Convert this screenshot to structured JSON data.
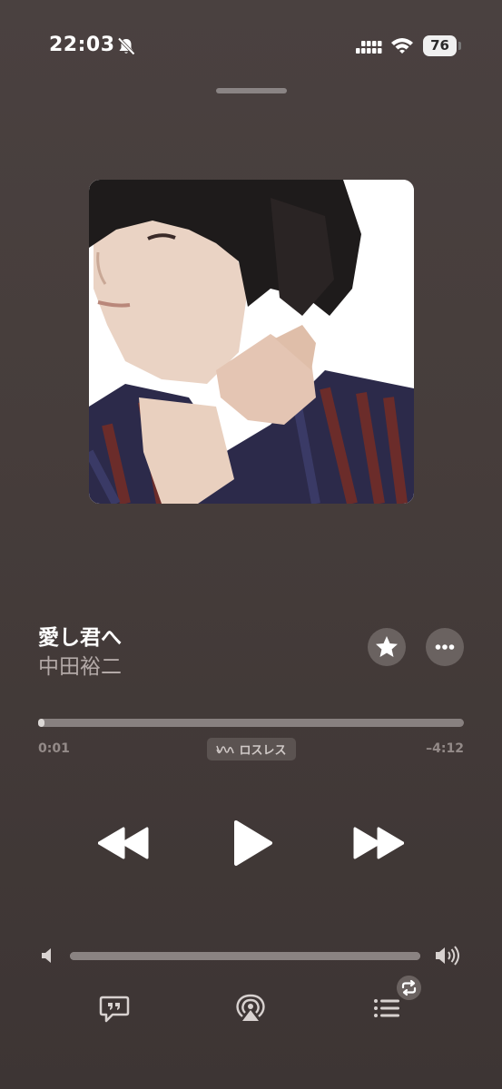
{
  "status_bar": {
    "time": "22:03",
    "battery_percent": "76",
    "icons": [
      "bell-slash-icon",
      "cellular-signal-icon",
      "wifi-icon",
      "battery-icon"
    ]
  },
  "now_playing": {
    "title": "愛し君へ",
    "artist": "中田裕二",
    "artwork_icon": "album-artwork"
  },
  "actions": {
    "favorite_icon": "star-icon",
    "more_icon": "ellipsis-icon"
  },
  "progress": {
    "elapsed": "0:01",
    "remaining": "–4:12",
    "fraction": 0.004,
    "badge_label": "ロスレス",
    "badge_icon": "lossless-icon"
  },
  "transport": {
    "rewind_icon": "backward-icon",
    "play_icon": "play-icon",
    "forward_icon": "forward-icon"
  },
  "volume": {
    "level": 1.0,
    "low_icon": "speaker-icon",
    "high_icon": "speaker-wave-icon"
  },
  "bottom_bar": {
    "lyrics_icon": "quote-bubble-icon",
    "airplay_icon": "airplay-audio-icon",
    "queue_icon": "list-icon",
    "repeat_badge_icon": "repeat-icon"
  },
  "colors": {
    "background": "#463d3b",
    "primary_text": "#ffffff",
    "secondary_text": "#b3a9a7",
    "track": "#888180",
    "track_fill": "#dcd8d6"
  }
}
